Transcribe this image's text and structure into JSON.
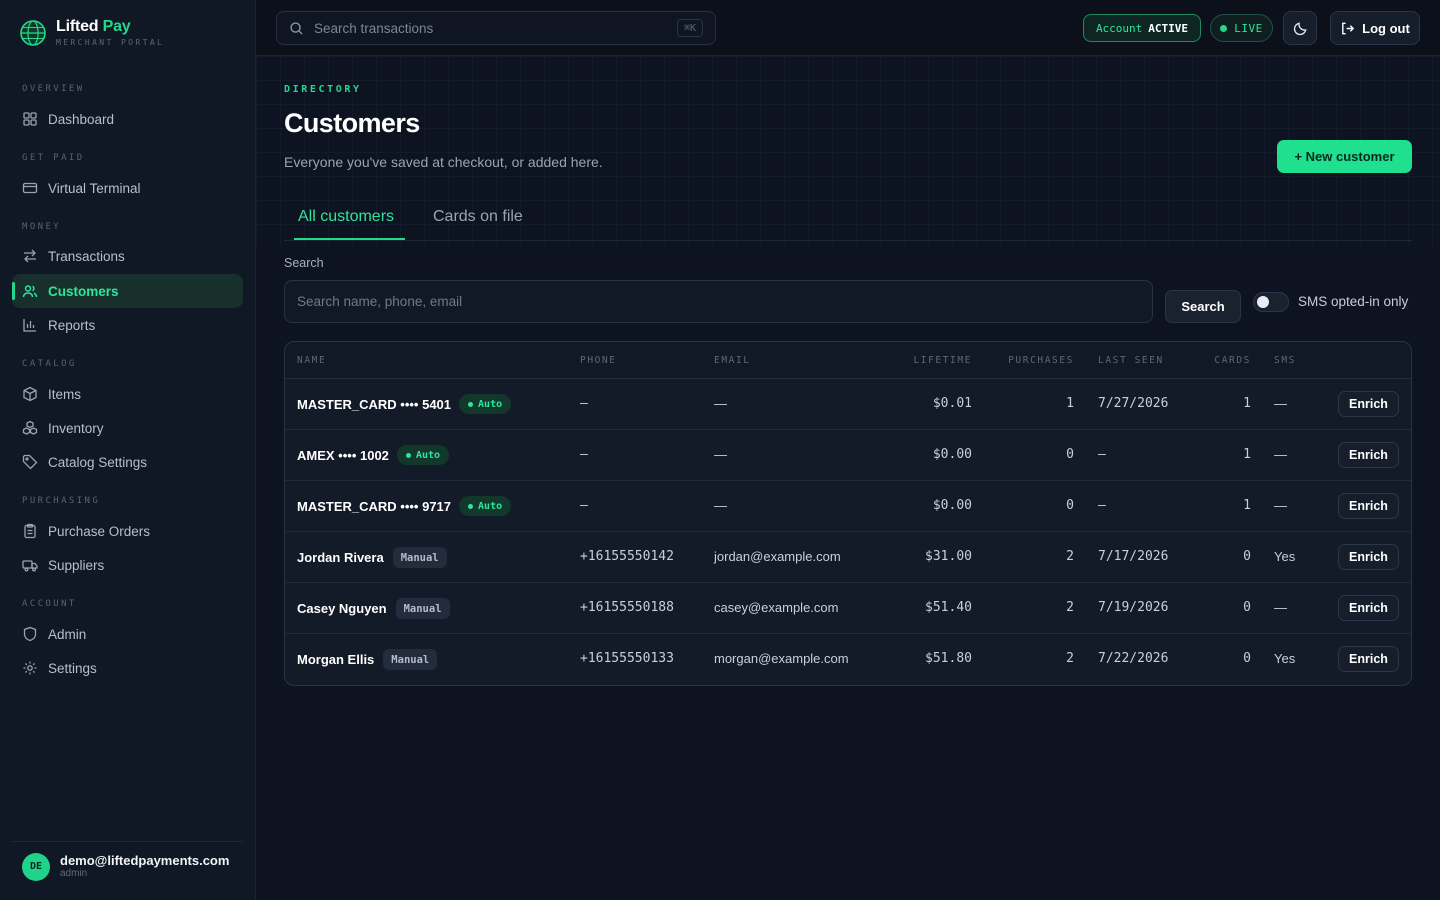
{
  "brand": {
    "name_part1": "Lifted",
    "name_part2": "Pay",
    "subtitle": "MERCHANT PORTAL"
  },
  "sidebar": {
    "sections": [
      {
        "title": "OVERVIEW"
      },
      {
        "title": "GET PAID"
      },
      {
        "title": "MONEY"
      },
      {
        "title": "CATALOG"
      },
      {
        "title": "PURCHASING"
      },
      {
        "title": "ACCOUNT"
      }
    ],
    "items": [
      {
        "label": "Dashboard",
        "icon": "grid-icon"
      },
      {
        "label": "Virtual Terminal",
        "icon": "credit-card-icon"
      },
      {
        "label": "Transactions",
        "icon": "arrows-icon"
      },
      {
        "label": "Customers",
        "icon": "users-icon",
        "active": true
      },
      {
        "label": "Reports",
        "icon": "bar-chart-icon"
      },
      {
        "label": "Items",
        "icon": "box-icon"
      },
      {
        "label": "Inventory",
        "icon": "boxes-icon"
      },
      {
        "label": "Catalog Settings",
        "icon": "tag-icon"
      },
      {
        "label": "Purchase Orders",
        "icon": "clipboard-icon"
      },
      {
        "label": "Suppliers",
        "icon": "truck-icon"
      },
      {
        "label": "Admin",
        "icon": "shield-icon"
      },
      {
        "label": "Settings",
        "icon": "gear-icon"
      }
    ],
    "user": {
      "initials": "DE",
      "email": "demo@liftedpayments.com",
      "role": "admin"
    }
  },
  "topbar": {
    "search_placeholder": "Search transactions",
    "shortcut": "⌘K",
    "account_label": "Account",
    "account_status": "ACTIVE",
    "live_label": "LIVE",
    "logout_label": "Log out"
  },
  "page": {
    "eyebrow": "DIRECTORY",
    "title": "Customers",
    "subtitle": "Everyone you've saved at checkout, or added here.",
    "new_button": "+ New customer",
    "tabs": [
      {
        "label": "All customers",
        "active": true
      },
      {
        "label": "Cards on file",
        "active": false
      }
    ],
    "search_label": "Search",
    "search_placeholder": "Search name, phone, email",
    "search_button": "Search",
    "toggle_label": "SMS opted-in only",
    "toggle_on": false
  },
  "table": {
    "columns": [
      "NAME",
      "PHONE",
      "EMAIL",
      "LIFETIME",
      "PURCHASES",
      "LAST SEEN",
      "CARDS",
      "SMS"
    ],
    "action_label": "Enrich",
    "rows": [
      {
        "name": "MASTER_CARD •••• 5401",
        "badge": "Auto",
        "phone": "—",
        "email": "—",
        "lifetime": "$0.01",
        "purchases": "1",
        "last_seen": "7/27/2026",
        "cards": "1",
        "sms": "—"
      },
      {
        "name": "AMEX •••• 1002",
        "badge": "Auto",
        "phone": "—",
        "email": "—",
        "lifetime": "$0.00",
        "purchases": "0",
        "last_seen": "—",
        "cards": "1",
        "sms": "—"
      },
      {
        "name": "MASTER_CARD •••• 9717",
        "badge": "Auto",
        "phone": "—",
        "email": "—",
        "lifetime": "$0.00",
        "purchases": "0",
        "last_seen": "—",
        "cards": "1",
        "sms": "—"
      },
      {
        "name": "Jordan Rivera",
        "badge": "Manual",
        "phone": "+16155550142",
        "email": "jordan@example.com",
        "lifetime": "$31.00",
        "purchases": "2",
        "last_seen": "7/17/2026",
        "cards": "0",
        "sms": "Yes"
      },
      {
        "name": "Casey Nguyen",
        "badge": "Manual",
        "phone": "+16155550188",
        "email": "casey@example.com",
        "lifetime": "$51.40",
        "purchases": "2",
        "last_seen": "7/19/2026",
        "cards": "0",
        "sms": "—"
      },
      {
        "name": "Morgan Ellis",
        "badge": "Manual",
        "phone": "+16155550133",
        "email": "morgan@example.com",
        "lifetime": "$51.80",
        "purchases": "2",
        "last_seen": "7/22/2026",
        "cards": "0",
        "sms": "Yes"
      }
    ]
  },
  "colors": {
    "accent": "#22d98b",
    "background": "#0e1322",
    "sidebar": "#101826"
  }
}
